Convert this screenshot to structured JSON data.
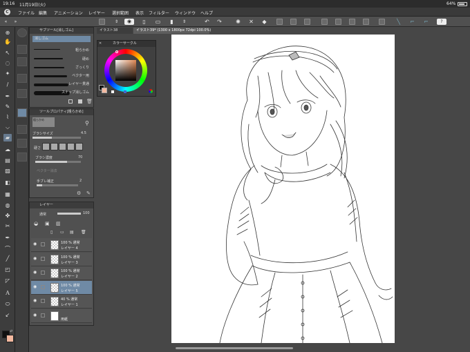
{
  "status": {
    "time": "19:16",
    "date": "11月19日(火)",
    "battery": "64%"
  },
  "menu": {
    "items": [
      "ファイル",
      "編集",
      "アニメーション",
      "レイヤー",
      "選択範囲",
      "表示",
      "フィルター",
      "ウィンドウ",
      "ヘルプ"
    ]
  },
  "tabs": {
    "tab1": "イラスト38",
    "tab2": "イラスト39* (1300 x 1800px 72dpi 100.0%)"
  },
  "subtool": {
    "title": "サブツール[消しゴム]",
    "category": "消しゴム",
    "brushes": [
      "粗らかめ",
      "硬め",
      "ざっくり",
      "ベクター用",
      "レイヤー貫通",
      "スナップ消しゴム"
    ]
  },
  "toolprop": {
    "title": "ツールプロパティ[粗らかめ]",
    "preset": "粗らかめ",
    "brush_size_label": "ブラシサイズ",
    "brush_size": "4.5",
    "hardness_label": "硬さ",
    "density_label": "ブラシ濃度",
    "density": "70",
    "vector_label": "ベクター消去",
    "stabilization_label": "手ブレ補正",
    "stabilization": "2"
  },
  "colorwheel": {
    "title": "カラーサークル"
  },
  "layers": {
    "title": "レイヤー",
    "blend_mode": "通常",
    "opacity": "100",
    "items": [
      {
        "line1": "100 % 通常",
        "line2": "レイヤー 4",
        "selected": false,
        "plain": false
      },
      {
        "line1": "100 % 通常",
        "line2": "レイヤー 3",
        "selected": false,
        "plain": false
      },
      {
        "line1": "100 % 通常",
        "line2": "レイヤー 2",
        "selected": false,
        "plain": false
      },
      {
        "line1": "100 % 通常",
        "line2": "レイヤー 5",
        "selected": true,
        "plain": false
      },
      {
        "line1": "40 % 通常",
        "line2": "レイヤー 1",
        "selected": false,
        "plain": false
      },
      {
        "line1": "",
        "line2": "用紙",
        "selected": false,
        "plain": true
      }
    ]
  },
  "colors": {
    "main": "#111111",
    "sub": "#f4b9a0",
    "accent_selected": "#6f8aa5"
  }
}
